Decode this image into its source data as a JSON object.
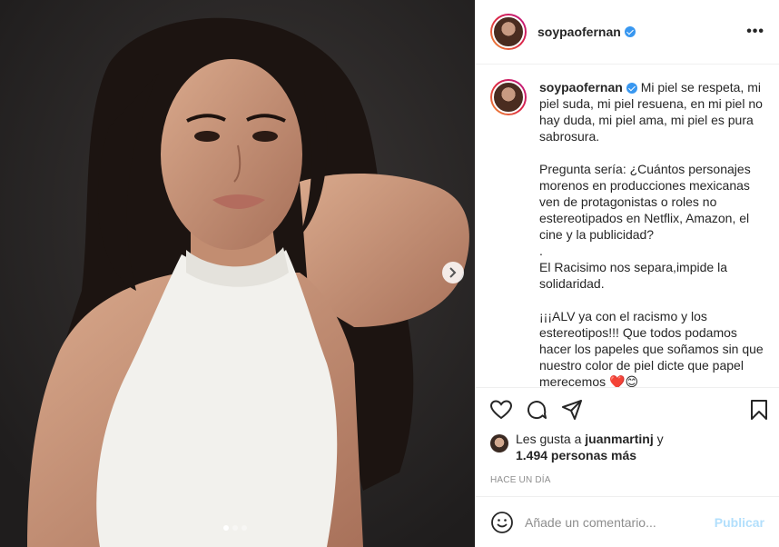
{
  "post": {
    "username": "soypaofernan",
    "verified": true,
    "more_icon": "more-horizontal-icon",
    "caption_lines": "Mi piel se respeta, mi piel suda, mi piel resuena, en mi piel no hay duda, mi piel ama, mi piel es pura sabrosura.\n\nPregunta sería: ¿Cuántos personajes morenos en producciones mexicanas ven de protagonistas o roles no estereotipados en Netflix, Amazon, el cine y la publicidad?\n.\nEl Racisimo nos separa,impide la solidaridad.\n\n¡¡¡ALV ya con el racismo y los estereotipos!!! Que todos podamos hacer los papeles que soñamos sin que nuestro color de piel dicte que papel merecemos ❤️😊",
    "likes": {
      "prefix": "Les gusta a ",
      "user": "juanmartinj",
      "connector": " y",
      "count": "1.494 personas más"
    },
    "timestamp": "HACE UN DÍA",
    "comment_placeholder": "Añade un comentario...",
    "publish_label": "Publicar",
    "carousel": {
      "total": 3,
      "current": 1
    },
    "accent_color": "#3897f0"
  }
}
